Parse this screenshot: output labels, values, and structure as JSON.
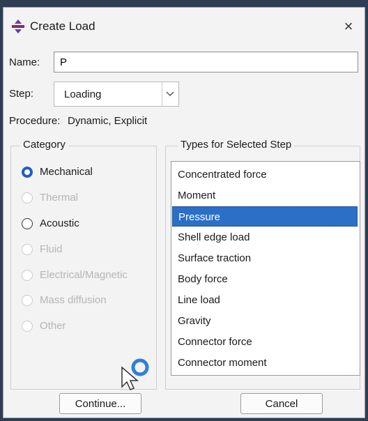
{
  "window": {
    "title": "Create Load",
    "close_glyph": "×"
  },
  "form": {
    "name_label": "Name:",
    "name_value": "P",
    "step_label": "Step:",
    "step_value": "Loading",
    "procedure_label": "Procedure:",
    "procedure_value": "Dynamic, Explicit"
  },
  "category": {
    "title": "Category",
    "options": [
      {
        "label": "Mechanical",
        "checked": true,
        "enabled": true
      },
      {
        "label": "Thermal",
        "checked": false,
        "enabled": false
      },
      {
        "label": "Acoustic",
        "checked": false,
        "enabled": true
      },
      {
        "label": "Fluid",
        "checked": false,
        "enabled": false
      },
      {
        "label": "Electrical/Magnetic",
        "checked": false,
        "enabled": false
      },
      {
        "label": "Mass diffusion",
        "checked": false,
        "enabled": false
      },
      {
        "label": "Other",
        "checked": false,
        "enabled": false
      }
    ]
  },
  "types": {
    "title": "Types for Selected Step",
    "selected": "Pressure",
    "items": [
      "Concentrated force",
      "Moment",
      "Pressure",
      "Shell edge load",
      "Surface traction",
      "Body force",
      "Line load",
      "Gravity",
      "Connector force",
      "Connector moment"
    ]
  },
  "buttons": {
    "continue": "Continue...",
    "cancel": "Cancel"
  },
  "colors": {
    "selection": "#2c6fc7",
    "radio_checked": "#1f5fbf",
    "disabled_text": "#b5b5b5"
  }
}
